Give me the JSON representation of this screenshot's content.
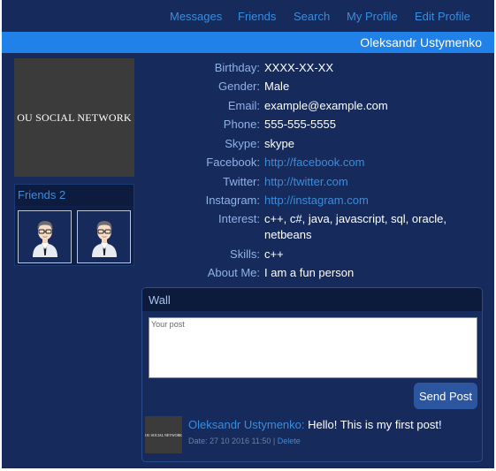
{
  "nav": {
    "messages": "Messages",
    "friends": "Friends",
    "search": "Search",
    "my_profile": "My Profile",
    "edit_profile": "Edit Profile"
  },
  "profile_name": "Oleksandr Ustymenko",
  "logo_text": "OU SOCIAL NETWORK",
  "friends_panel": {
    "title": "Friends 2",
    "friends": [
      {
        "avatar_icon": "man-with-glasses-avatar-icon"
      },
      {
        "avatar_icon": "man-with-glasses-avatar-icon"
      }
    ]
  },
  "info": [
    {
      "label": "Birthday:",
      "value": "XXXX-XX-XX"
    },
    {
      "label": "Gender:",
      "value": "Male"
    },
    {
      "label": "Email:",
      "value": "example@example.com"
    },
    {
      "label": "Phone:",
      "value": "555-555-5555"
    },
    {
      "label": "Skype:",
      "value": "skype"
    },
    {
      "label": "Facebook:",
      "value": "http://facebook.com"
    },
    {
      "label": "Twitter:",
      "value": "http://twitter.com"
    },
    {
      "label": "Instagram:",
      "value": "http://instagram.com"
    },
    {
      "label": "Interest:",
      "value": "c++, c#, java, javascript, sql, oracle, netbeans"
    },
    {
      "label": "Skills:",
      "value": "c++"
    },
    {
      "label": "About Me:",
      "value": "I am a fun person"
    }
  ],
  "wall": {
    "title": "Wall",
    "placeholder": "Your post",
    "send_label": "Send Post",
    "post": {
      "author": "Oleksandr Ustymenko:",
      "text": "Hello! This is my first post!",
      "date": "Date: 27 10 2016 11:50 |",
      "delete_label": "Delete",
      "thumb_text": "OU SOCIAL NETWORK"
    }
  },
  "colors": {
    "background": "#162a5b",
    "accent_bar": "#2081e8",
    "link": "#3a8ddd",
    "label": "#8fb2e6",
    "button": "#2d56a0"
  }
}
